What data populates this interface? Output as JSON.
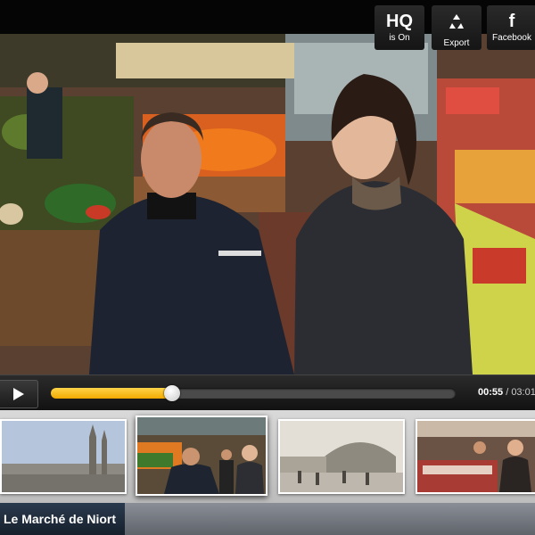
{
  "toolbar": {
    "hq": {
      "glyph": "HQ",
      "label": "is On"
    },
    "export": {
      "label": "Export",
      "icon": "recycle-export-icon"
    },
    "facebook": {
      "glyph": "f",
      "label": "Facebook"
    }
  },
  "player": {
    "play_icon": "play-icon",
    "progress_percent": 30,
    "current_time": "00:55",
    "separator": " / ",
    "total_time": "03:01",
    "accent_color": "#f5b400"
  },
  "thumbnails": [
    {
      "name": "cathedral-town-view",
      "active": false
    },
    {
      "name": "market-interview",
      "active": true
    },
    {
      "name": "old-market-hall-photo",
      "active": false
    },
    {
      "name": "butcher-stall",
      "active": false
    }
  ],
  "title": "Le Marché de Niort"
}
